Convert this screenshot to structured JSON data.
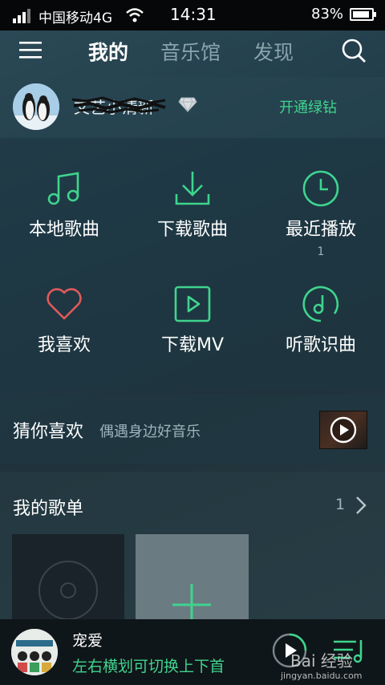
{
  "status_bar": {
    "carrier": "中国移动4G",
    "time": "14:31",
    "battery": "83%"
  },
  "nav": {
    "tabs": [
      {
        "label": "我的",
        "active": true
      },
      {
        "label": "音乐馆",
        "active": false
      },
      {
        "label": "发现",
        "active": false
      }
    ],
    "menu_icon": "menu-icon",
    "search_icon": "search-icon"
  },
  "profile": {
    "username": "文艺小清新",
    "vip_icon": "diamond-icon",
    "action": "开通绿钻"
  },
  "grid": [
    {
      "label": "本地歌曲",
      "icon": "music-note-icon"
    },
    {
      "label": "下载歌曲",
      "icon": "download-icon"
    },
    {
      "label": "最近播放",
      "icon": "clock-icon",
      "count": "1"
    },
    {
      "label": "我喜欢",
      "icon": "heart-icon"
    },
    {
      "label": "下载MV",
      "icon": "play-box-icon"
    },
    {
      "label": "听歌识曲",
      "icon": "music-recognition-icon"
    }
  ],
  "guess": {
    "title": "猜你喜欢",
    "subtitle": "偶遇身边好音乐"
  },
  "playlists": {
    "title": "我的歌单",
    "count": "1"
  },
  "player": {
    "song": "宠爱",
    "hint": "左右横划可切换上下首"
  },
  "watermark": {
    "text": "Bai 经验",
    "url": "jingyan.baidu.com"
  },
  "colors": {
    "accent_green": "#3fd48e",
    "heart_red": "#e05a5a"
  }
}
